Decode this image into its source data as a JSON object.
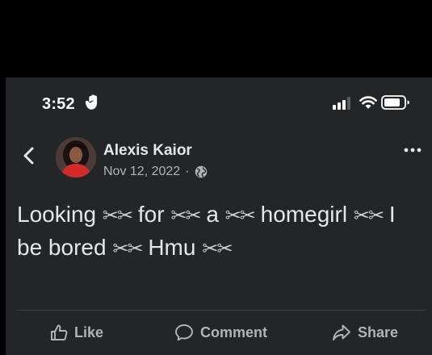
{
  "status_bar": {
    "time": "3:52"
  },
  "post": {
    "author": "Alexis Kaior",
    "date": "Nov 12, 2022",
    "separator": "·",
    "audience_icon": "globe-icon",
    "text_parts": [
      "Looking ",
      "✂✂",
      " for ",
      "✂✂",
      " a ",
      "✂✂",
      " homegirl ",
      "✂✂",
      " I be bored ",
      "✂✂",
      " Hmu ",
      "✂✂"
    ]
  },
  "actions": {
    "like": "Like",
    "comment": "Comment",
    "share": "Share"
  },
  "colors": {
    "background": "#242526",
    "text": "#e4e6eb",
    "muted": "#b0b3b8"
  }
}
